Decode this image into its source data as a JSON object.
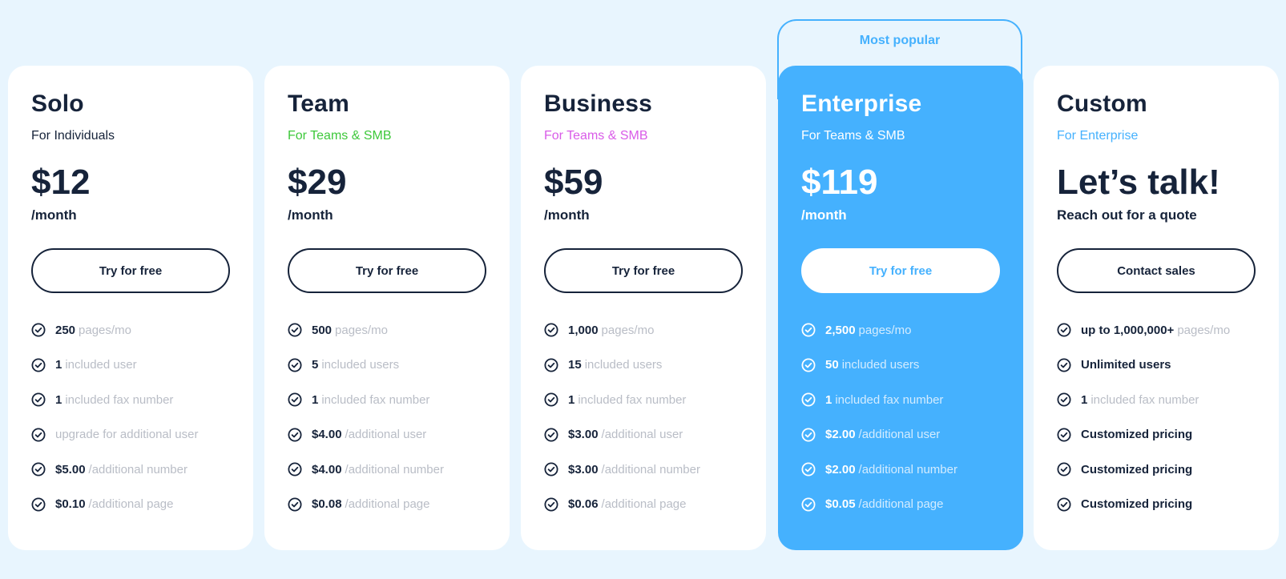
{
  "popular_label": "Most popular",
  "colors": {
    "background": "#e8f5fe",
    "accent": "#45b1fe",
    "text_dark": "#16233a",
    "muted": "#b9bdc6",
    "team_subtitle": "#3ec83b",
    "business_subtitle": "#d95ce8",
    "custom_subtitle": "#45b1fe"
  },
  "plans": [
    {
      "name": "Solo",
      "subtitle": "For Individuals",
      "subtitle_color": "#16233a",
      "price": "$12",
      "period": "/month",
      "cta": "Try for free",
      "features": [
        {
          "strong": "250",
          "muted": "pages/mo"
        },
        {
          "strong": "1",
          "muted": "included user"
        },
        {
          "strong": "1",
          "muted": "included fax number"
        },
        {
          "strong": "",
          "muted": "upgrade for additional user"
        },
        {
          "strong": "$5.00",
          "muted": "/additional number"
        },
        {
          "strong": "$0.10",
          "muted": "/additional page"
        }
      ]
    },
    {
      "name": "Team",
      "subtitle": "For Teams & SMB",
      "subtitle_color": "#3ec83b",
      "price": "$29",
      "period": "/month",
      "cta": "Try for free",
      "features": [
        {
          "strong": "500",
          "muted": "pages/mo"
        },
        {
          "strong": "5",
          "muted": "included users"
        },
        {
          "strong": "1",
          "muted": "included fax number"
        },
        {
          "strong": "$4.00",
          "muted": "/additional user"
        },
        {
          "strong": "$4.00",
          "muted": "/additional number"
        },
        {
          "strong": "$0.08",
          "muted": "/additional page"
        }
      ]
    },
    {
      "name": "Business",
      "subtitle": "For Teams & SMB",
      "subtitle_color": "#d95ce8",
      "price": "$59",
      "period": "/month",
      "cta": "Try for free",
      "features": [
        {
          "strong": "1,000",
          "muted": "pages/mo"
        },
        {
          "strong": "15",
          "muted": "included users"
        },
        {
          "strong": "1",
          "muted": "included fax number"
        },
        {
          "strong": "$3.00",
          "muted": "/additional user"
        },
        {
          "strong": "$3.00",
          "muted": "/additional number"
        },
        {
          "strong": "$0.06",
          "muted": "/additional page"
        }
      ]
    },
    {
      "name": "Enterprise",
      "subtitle": "For Teams & SMB",
      "subtitle_color": "#ffffff",
      "price": "$119",
      "period": "/month",
      "cta": "Try for free",
      "features": [
        {
          "strong": "2,500",
          "muted": "pages/mo"
        },
        {
          "strong": "50",
          "muted": "included users"
        },
        {
          "strong": "1",
          "muted": "included fax number"
        },
        {
          "strong": "$2.00",
          "muted": "/additional user"
        },
        {
          "strong": "$2.00",
          "muted": "/additional number"
        },
        {
          "strong": "$0.05",
          "muted": "/additional page"
        }
      ]
    },
    {
      "name": "Custom",
      "subtitle": "For Enterprise",
      "subtitle_color": "#45b1fe",
      "price": "Let’s talk!",
      "period": "Reach out for a quote",
      "cta": "Contact sales",
      "features": [
        {
          "strong": "up to 1,000,000+",
          "muted": "pages/mo"
        },
        {
          "strong": "Unlimited users",
          "muted": ""
        },
        {
          "strong": "1",
          "muted": "included fax number"
        },
        {
          "strong": "Customized pricing",
          "muted": ""
        },
        {
          "strong": "Customized pricing",
          "muted": ""
        },
        {
          "strong": "Customized pricing",
          "muted": ""
        }
      ]
    }
  ]
}
